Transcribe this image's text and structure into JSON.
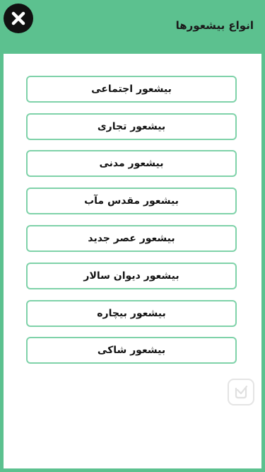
{
  "header": {
    "title": "انواع بیشعورها",
    "close_icon": "close-icon"
  },
  "menu": {
    "items": [
      {
        "label": "بیشعور اجتماعی"
      },
      {
        "label": "بیشعور تجاری"
      },
      {
        "label": "بیشعور مدنی"
      },
      {
        "label": "بیشعور مقدس مآب"
      },
      {
        "label": "بیشعور عصر جدید"
      },
      {
        "label": "بیشعور دیوان سالار"
      },
      {
        "label": "بیشعور بیچاره"
      },
      {
        "label": "بیشعور شاکی"
      }
    ]
  },
  "colors": {
    "accent": "#5cc18f",
    "button_border": "#7fd2a9",
    "close_bg": "#111111"
  },
  "watermark": {
    "icon": "app-store-badge-icon"
  }
}
